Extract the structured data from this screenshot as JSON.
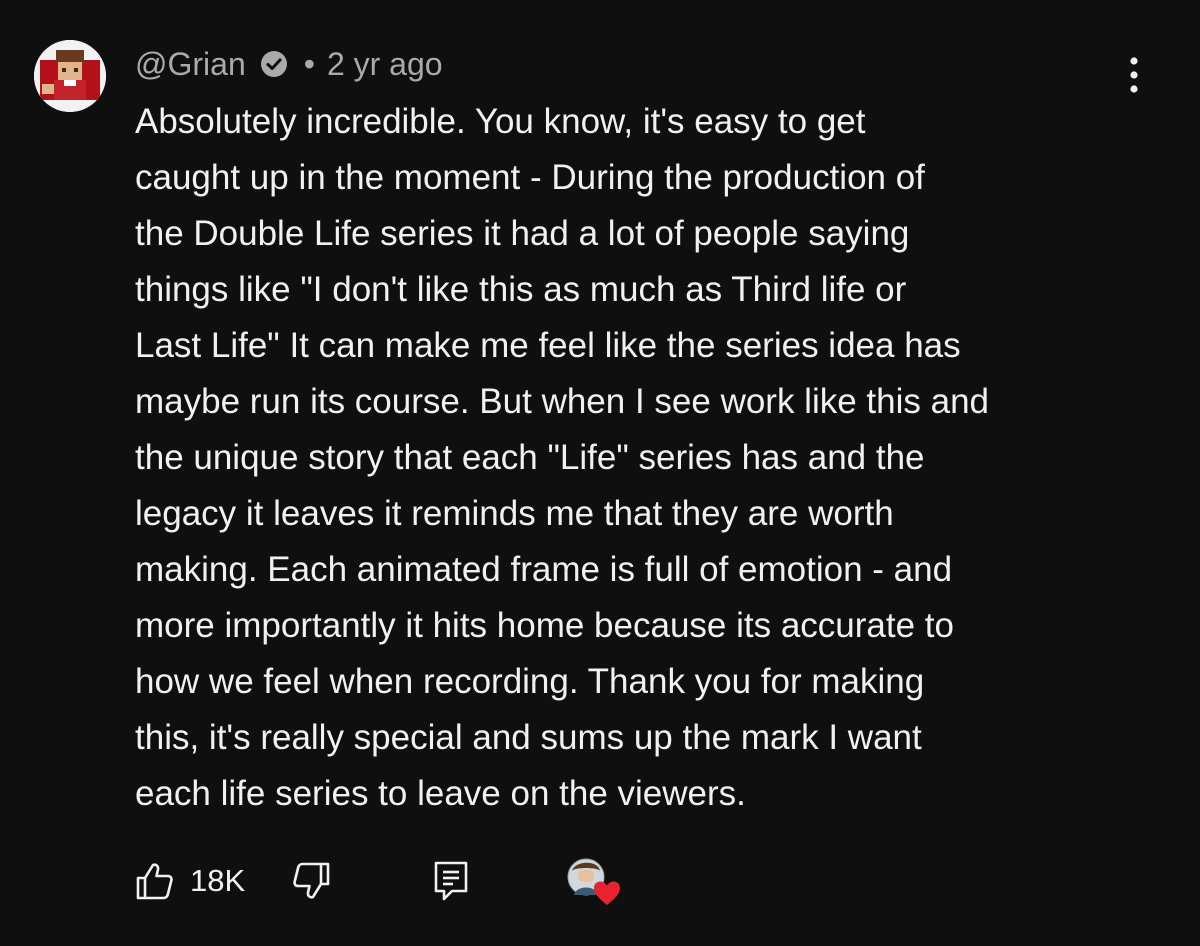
{
  "comment": {
    "handle": "@Grian",
    "separator": "•",
    "timestamp": "2 yr ago",
    "verified": true,
    "avatar_icon": "grian-avatar",
    "text_lines": [
      "Absolutely incredible. You know, it's easy to get",
      "caught up in the moment - During the production of",
      "the Double Life series it had a lot of people saying",
      "things like \"I don't like this as much as Third life or",
      "Last Life\" It can make me feel like the series idea has",
      "maybe run its course. But when I see work like this and",
      "the unique story that each \"Life\" series has and the",
      "legacy it leaves it reminds me that they are worth",
      "making. Each animated frame is full of emotion - and",
      "more importantly it hits home because its accurate to",
      "how we feel when recording. Thank you for making",
      "this, it's really special and sums up the mark I want",
      "each life series to leave on the viewers."
    ],
    "actions": {
      "like_count": "18K",
      "like_icon": "thumbs-up-icon",
      "dislike_icon": "thumbs-down-icon",
      "reply_icon": "reply-comment-icon",
      "creator_heart_icon": "creator-heart-icon",
      "menu_icon": "more-vert-icon"
    }
  },
  "colors": {
    "background": "#0f0f0f",
    "text_primary": "#f1f1f1",
    "text_secondary": "#aaaaaa",
    "heart": "#e8222e"
  }
}
